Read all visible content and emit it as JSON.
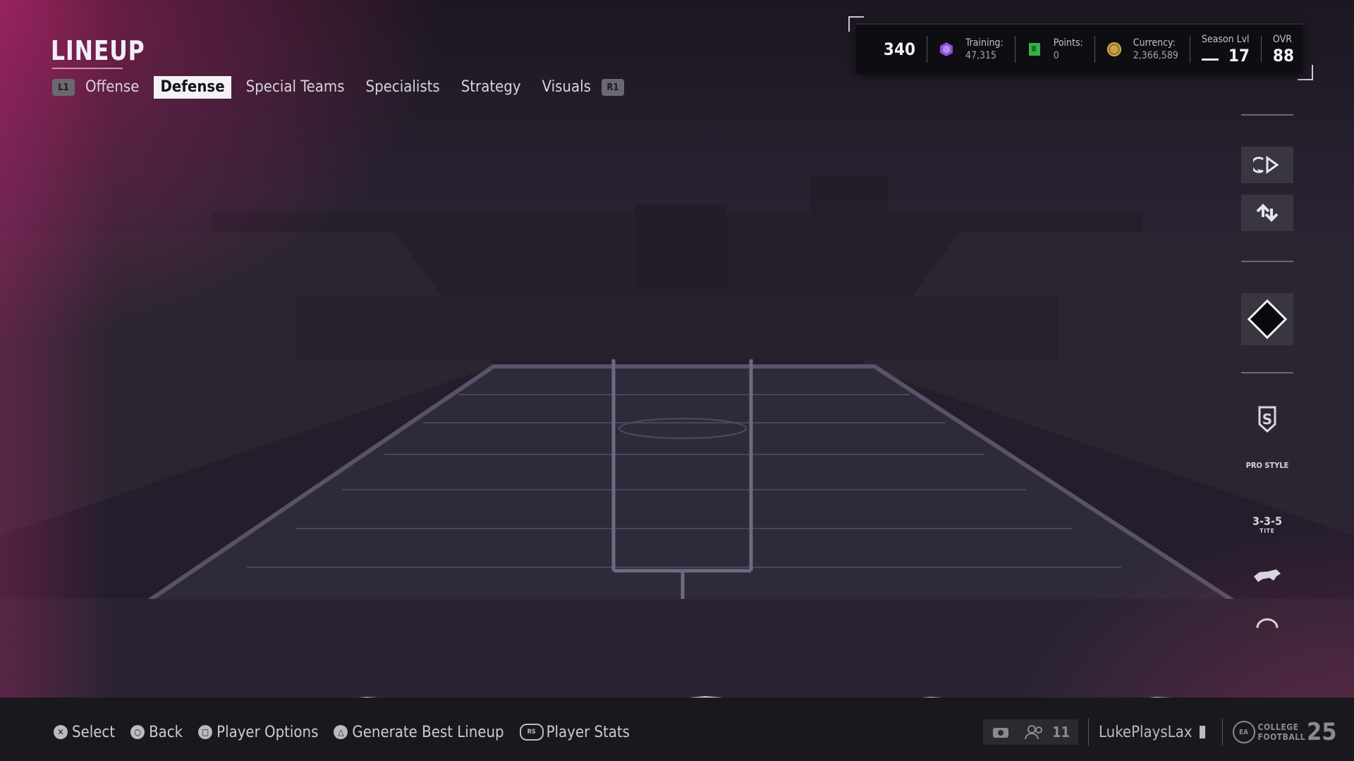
{
  "header": {
    "title": "LINEUP",
    "left_bumper": "L1",
    "right_bumper": "R1",
    "tabs": [
      {
        "label": "Offense",
        "active": false
      },
      {
        "label": "Defense",
        "active": true
      },
      {
        "label": "Special Teams",
        "active": false
      },
      {
        "label": "Specialists",
        "active": false
      },
      {
        "label": "Strategy",
        "active": false
      },
      {
        "label": "Visuals",
        "active": false
      }
    ]
  },
  "stats": {
    "team_value": "340",
    "training_label": "Training:",
    "training_value": "47,315",
    "points_label": "Points:",
    "points_value": "0",
    "currency_label": "Currency:",
    "currency_value": "2,366,589",
    "season_label": "Season Lvl",
    "season_value": "17",
    "ovr_label": "OVR",
    "ovr_value": "88"
  },
  "rail": {
    "offense_style": "PRO STYLE",
    "formation": "3-3-5",
    "formation_sub": "TITE"
  },
  "footer": {
    "hints": [
      {
        "glyph": "✕",
        "label": "Select"
      },
      {
        "glyph": "○",
        "label": "Back"
      },
      {
        "glyph": "□",
        "label": "Player Options"
      },
      {
        "glyph": "△",
        "label": "Generate Best Lineup"
      },
      {
        "glyph": "RS",
        "label": "Player Stats"
      }
    ],
    "party_count": "11",
    "gamertag": "LukePlaysLax",
    "logo_top": "COLLEGE",
    "logo_bottom": "FOOTBALL",
    "logo_num": "25",
    "logo_ea": "EA"
  },
  "colors": {
    "accent_pink": "#d8287a",
    "active_tab_bg": "#f4f2f6",
    "training_gem": "#8c4fd6",
    "points_gem": "#36b24a",
    "currency_coin": "#c9a24a"
  }
}
